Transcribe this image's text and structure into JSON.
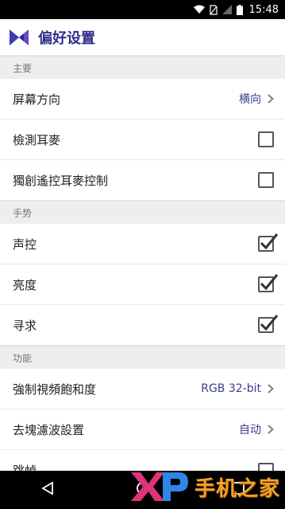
{
  "status_bar": {
    "time": "15:48"
  },
  "app": {
    "title": "偏好设置"
  },
  "sections": [
    {
      "header": "主要",
      "rows": [
        {
          "label": "屏幕方向",
          "value": "横向",
          "type": "chevron"
        },
        {
          "label": "檢測耳麥",
          "type": "checkbox",
          "checked": false
        },
        {
          "label": "獨創遙控耳麥控制",
          "type": "checkbox",
          "checked": false
        }
      ]
    },
    {
      "header": "手势",
      "rows": [
        {
          "label": "声控",
          "type": "checkbox",
          "checked": true
        },
        {
          "label": "亮度",
          "type": "checkbox",
          "checked": true
        },
        {
          "label": "寻求",
          "type": "checkbox",
          "checked": true
        }
      ]
    },
    {
      "header": "功能",
      "rows": [
        {
          "label": "強制視頻飽和度",
          "value": "RGB 32-bit",
          "type": "chevron"
        },
        {
          "label": "去塊濾波設置",
          "value": "自动",
          "type": "chevron"
        },
        {
          "label": "跳幀",
          "type": "checkbox",
          "checked": false
        }
      ]
    }
  ],
  "watermark": {
    "text": "手机之家",
    "logo_text": "XP"
  },
  "colors": {
    "accent": "#2f2f8a",
    "value_text": "#3b3d8c",
    "section_bg": "#eeeeee",
    "watermark": "#f2a22b"
  }
}
